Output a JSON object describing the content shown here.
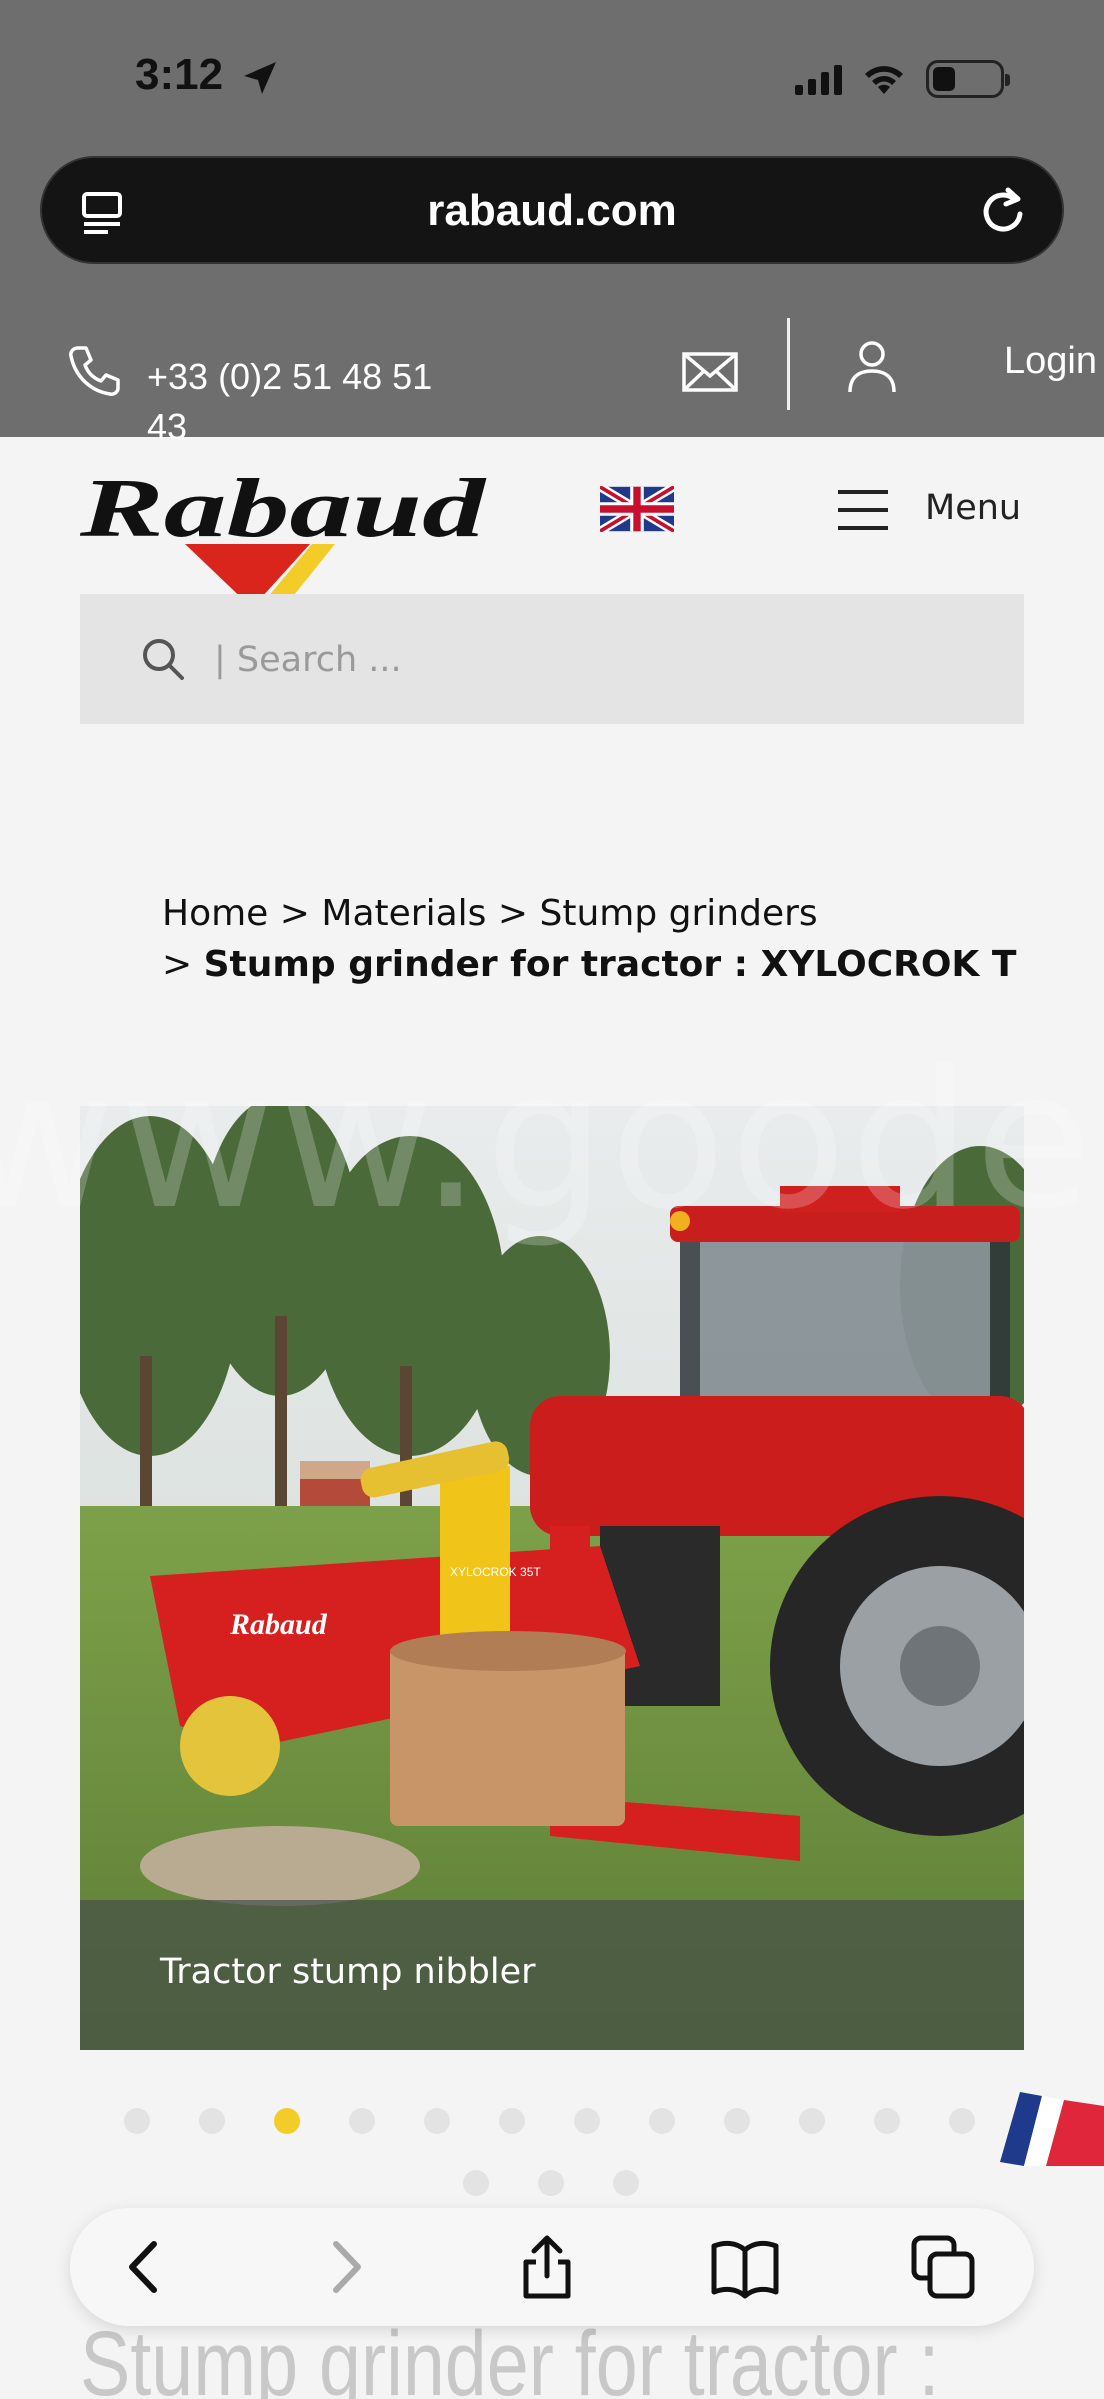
{
  "status": {
    "time": "3:12"
  },
  "browser": {
    "url": "rabaud.com"
  },
  "contact": {
    "phone": "+33 (0)2 51 48 51 43",
    "login_label": "Login"
  },
  "header": {
    "logo_text": "Rabaud",
    "menu_label": "Menu"
  },
  "search": {
    "placeholder": "| Search ..."
  },
  "breadcrumb": {
    "home": "Home",
    "sep": ">",
    "materials": "Materials",
    "category": "Stump grinders",
    "current": "Stump grinder for tractor : XYLOCROK T"
  },
  "hero": {
    "caption": "Tractor stump nibbler",
    "watermark": "www.goodeal",
    "machine_brand": "Rabaud",
    "machine_model": "XYLOCROK 35T"
  },
  "carousel": {
    "total": 15,
    "active_index": 2
  },
  "page_heading": "Stump grinder for tractor :",
  "colors": {
    "brand_red": "#d9251c",
    "brand_yellow": "#f4cc28",
    "dot_active": "#f4cc28",
    "dot_inactive": "#e3e3e3"
  },
  "toolbar_icons": [
    "back-icon",
    "forward-icon",
    "share-icon",
    "bookmarks-icon",
    "tabs-icon"
  ]
}
